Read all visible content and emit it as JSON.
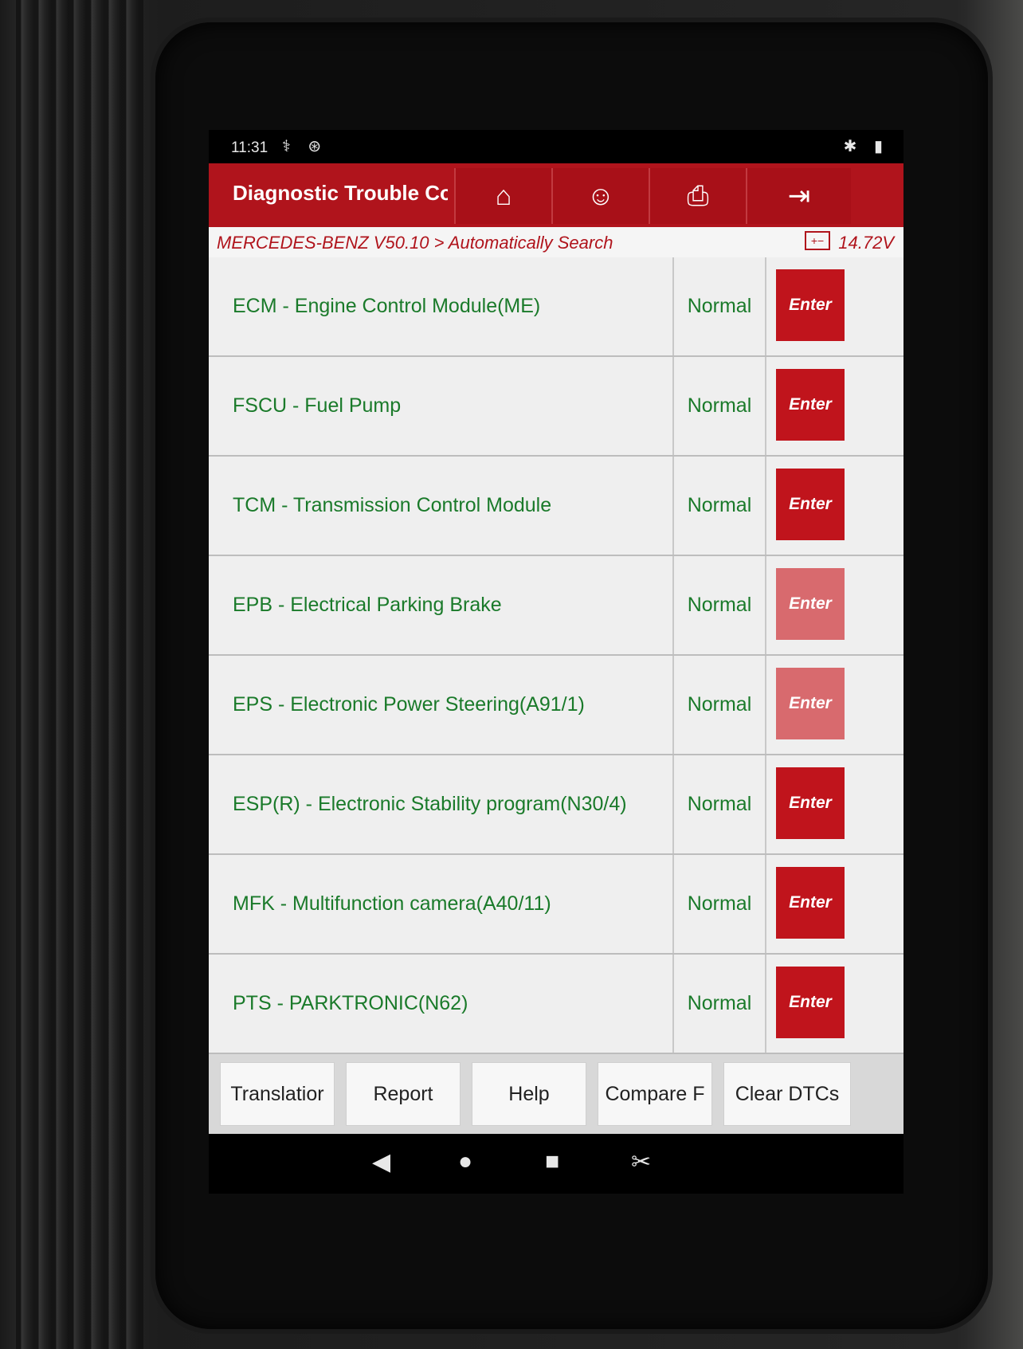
{
  "status_bar": {
    "time": "11:31",
    "left_icons": "⚕ ⊛",
    "right_icons": "✱ ▮"
  },
  "header": {
    "title": "Diagnostic Trouble Cod",
    "buttons": [
      {
        "icon": "home-icon",
        "glyph": "⌂"
      },
      {
        "icon": "support-agent-icon",
        "glyph": "☺"
      },
      {
        "icon": "print-icon",
        "glyph": "⎙"
      },
      {
        "icon": "exit-icon",
        "glyph": "⇥"
      }
    ]
  },
  "breadcrumb": {
    "path": "MERCEDES-BENZ V50.10 > Automatically Search",
    "battery_glyph": "+−",
    "voltage": "14.72V"
  },
  "modules": [
    {
      "name": "ECM - Engine Control Module(ME)",
      "status": "Normal",
      "action": "Enter"
    },
    {
      "name": "FSCU - Fuel Pump",
      "status": "Normal",
      "action": "Enter"
    },
    {
      "name": "TCM - Transmission Control Module",
      "status": "Normal",
      "action": "Enter"
    },
    {
      "name": "EPB - Electrical Parking Brake",
      "status": "Normal",
      "action": "Enter"
    },
    {
      "name": "EPS - Electronic Power Steering(A91/1)",
      "status": "Normal",
      "action": "Enter"
    },
    {
      "name": "ESP(R) - Electronic Stability program(N30/4)",
      "status": "Normal",
      "action": "Enter"
    },
    {
      "name": "MFK - Multifunction camera(A40/11)",
      "status": "Normal",
      "action": "Enter"
    },
    {
      "name": "PTS - PARKTRONIC(N62)",
      "status": "Normal",
      "action": "Enter"
    }
  ],
  "toolbar": {
    "translation": "Translatior",
    "report": "Report",
    "help": "Help",
    "compare": "Compare F",
    "clear_dtcs": "Clear DTCs"
  },
  "navbar": {
    "back": "◀",
    "home": "●",
    "recents": "■",
    "screenshot": "✂"
  },
  "colors": {
    "accent": "#b0141c",
    "text_green": "#1a7a2a",
    "enter_button": "#c0141c"
  }
}
